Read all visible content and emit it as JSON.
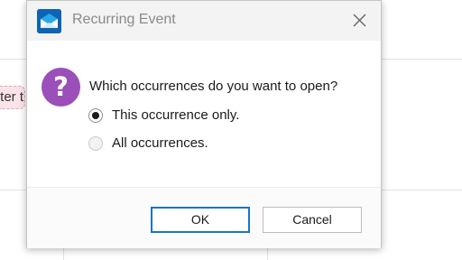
{
  "background": {
    "event_text": "ter t"
  },
  "dialog": {
    "title": "Recurring Event",
    "app_icon": "outlook-envelope-icon",
    "close_icon": "close-icon",
    "question_icon": "question-icon",
    "question_mark": "?",
    "prompt": "Which occurrences do you want to open?",
    "options": [
      {
        "label": "This occurrence only.",
        "selected": true
      },
      {
        "label": "All occurrences.",
        "selected": false
      }
    ],
    "ok_label": "OK",
    "cancel_label": "Cancel"
  },
  "colors": {
    "accent": "#1d72c8",
    "question_icon_bg": "#9b4fb8",
    "app_icon_bg": "#0f63b5",
    "event_bg": "#fbe3ea"
  }
}
